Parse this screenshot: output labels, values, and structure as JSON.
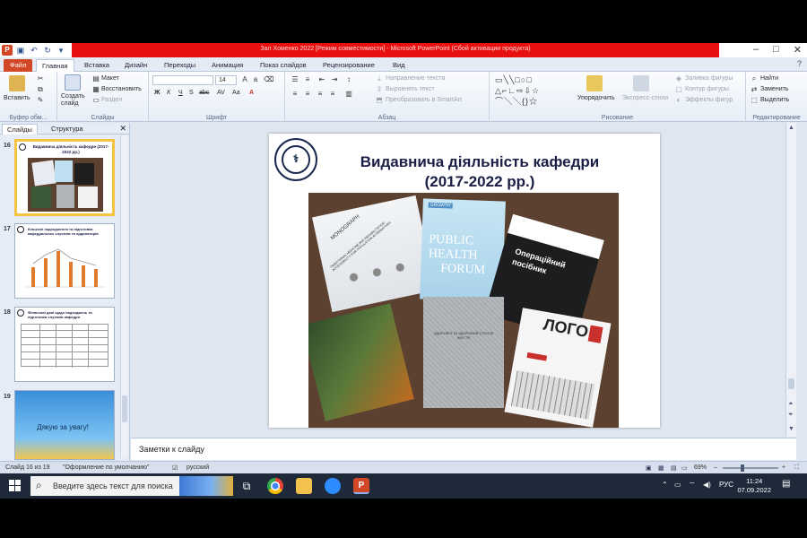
{
  "window": {
    "title": "Зал Хоменко 2022 [Режим совместимости] - Microsoft PowerPoint (Сбой активации продукта)",
    "controls": [
      "–",
      "□",
      "✕"
    ]
  },
  "ribbon_tabs": {
    "file": "Файл",
    "items": [
      "Главная",
      "Вставка",
      "Дизайн",
      "Переходы",
      "Анимация",
      "Показ слайдов",
      "Рецензирование",
      "Вид"
    ]
  },
  "ribbon": {
    "clipboard": {
      "paste": "Вставить",
      "label": "Буфер обм..."
    },
    "slides": {
      "create": "Создать слайд",
      "layout": "Макет",
      "restore": "Восстановить",
      "section": "Раздел",
      "label": "Слайды"
    },
    "font": {
      "font_name": "",
      "font_size": "14",
      "buttons": [
        "Ж",
        "К",
        "Ч",
        "S",
        "abc",
        "AV",
        "Аа",
        "А"
      ],
      "label": "Шрифт"
    },
    "paragraph": {
      "direction": "Направление текста",
      "align": "Выровнять текст",
      "smartart": "Преобразовать в SmartArt",
      "label": "Абзац"
    },
    "drawing": {
      "arrange": "Упорядочить",
      "styles": "Экспресс-стили",
      "fill": "Заливка фигуры",
      "outline": "Контур фигуры",
      "effects": "Эффекты фигур",
      "label": "Рисование"
    },
    "editing": {
      "find": "Найти",
      "replace": "Заменить",
      "select": "Выделить",
      "label": "Редактирование"
    }
  },
  "panel": {
    "tabs": [
      "Слайды",
      "Структура"
    ],
    "close": "✕",
    "thumbs": [
      {
        "num": "16",
        "title": "Видавнича діяльність кафедри (2017-2022 рр.)"
      },
      {
        "num": "17",
        "title": "Кількісні надходження та підготовка кафедральних слухачів та ординаторів"
      },
      {
        "num": "18",
        "title": "Фінансові дані щодо надходжень та підготовки слухачів кафедри"
      },
      {
        "num": "19",
        "title": "Дякую за увагу!"
      }
    ]
  },
  "slide": {
    "title_line1": "Видавнича діяльність кафедри",
    "title_line2": "(2017-2022 рр.)",
    "books": {
      "monograph": "MONOGRAPH",
      "monograph_sub": "TRADITIONAL MEDICINE AND REHABILITATION: ACCESSIBILITY FOR POPULATION ALTERNATIVES",
      "phf_growth": "GROWTH",
      "phf_line1": "PUBLIC",
      "phf_line2": "HEALTH",
      "phf_line3": "FORUM",
      "manual_line1": "Операційний",
      "manual_line2": "посібник",
      "book_grey": "ЗДОРОВ'Я ТА ЗДОРОВИЙ СПОСІБ ЖИТТЯ",
      "logo_word": "ЛОГО"
    }
  },
  "notes": {
    "placeholder": "Заметки к слайду"
  },
  "status": {
    "slide_info": "Слайд 16 из 19",
    "theme": "\"Оформление по умолчанию\"",
    "language": "русский",
    "zoom": "69%",
    "zoom_minus": "–",
    "zoom_plus": "+"
  },
  "taskbar": {
    "search_placeholder": "Введите здесь текст для поиска",
    "tray_language": "РУС",
    "time": "11:24",
    "date": "07.09.2022"
  },
  "colors": {
    "title_bar_accent": "#e8100f",
    "file_tab": "#d24726",
    "slide_title": "#1b1f45",
    "selected_thumb": "#f5c342"
  }
}
